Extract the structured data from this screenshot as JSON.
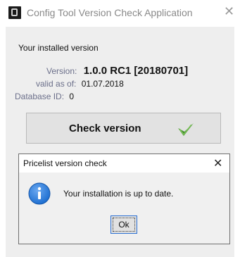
{
  "window": {
    "title": "Config Tool Version Check Application",
    "close_icon": "close-icon"
  },
  "installed": {
    "header": "Your installed version",
    "version_label": "Version:",
    "version_value": "1.0.0 RC1 [20180701]",
    "valid_label": "valid as of:",
    "valid_value": "01.07.2018",
    "db_label": "Database ID:",
    "db_value": "0"
  },
  "check_button": {
    "label": "Check version",
    "icon": "checkmark-icon",
    "icon_color": "#3f8a2c"
  },
  "dialog": {
    "title": "Pricelist version check",
    "close_icon": "close-icon",
    "icon": "info-icon",
    "icon_color": "#1e6fd1",
    "message": "Your installation is up to date.",
    "ok_label": "Ok"
  }
}
